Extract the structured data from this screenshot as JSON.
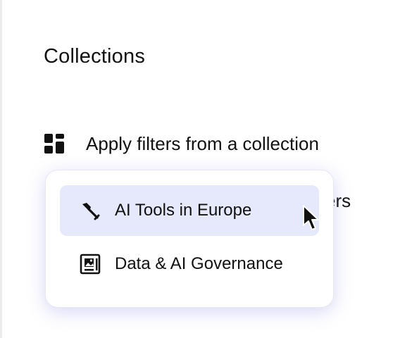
{
  "heading": "Collections",
  "collection_action": {
    "label": "Apply filters from a collection",
    "icon": "dashboard-grid-icon"
  },
  "obscured_row": {
    "visible_fragment": "ers"
  },
  "dropdown": {
    "items": [
      {
        "label": "AI Tools in Europe",
        "icon": "shovel-icon",
        "active": true
      },
      {
        "label": "Data & AI Governance",
        "icon": "image-frame-icon",
        "active": false
      }
    ],
    "highlight_color": "#e6e9fb"
  },
  "cursor": "mouse-pointer-icon"
}
